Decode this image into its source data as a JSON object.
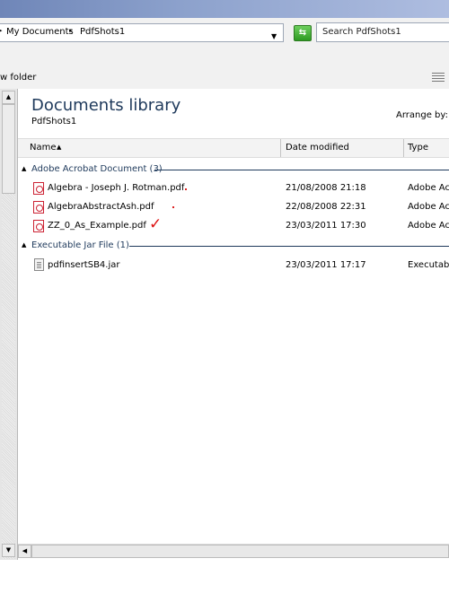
{
  "address": {
    "crumbs": [
      "My Documents",
      "PdfShots1"
    ],
    "search_placeholder": "Search PdfShots1"
  },
  "toolbar": {
    "new_folder_label": "w folder"
  },
  "library": {
    "title": "Documents library",
    "subtitle": "PdfShots1",
    "arrange_by_label": "Arrange by:"
  },
  "columns": {
    "name": "Name",
    "date": "Date modified",
    "type": "Type"
  },
  "groups": [
    {
      "label": "Adobe Acrobat Document (3)",
      "files": [
        {
          "name": "Algebra - Joseph J. Rotman.pdf",
          "date": "21/08/2008 21:18",
          "type": "Adobe Acr",
          "icon": "pdf-file-icon"
        },
        {
          "name": "AlgebraAbstractAsh.pdf",
          "date": "22/08/2008 22:31",
          "type": "Adobe Acr",
          "icon": "pdf-file-icon"
        },
        {
          "name": "ZZ_0_As_Example.pdf",
          "date": "23/03/2011 17:30",
          "type": "Adobe Acr",
          "icon": "pdf-file-icon"
        }
      ]
    },
    {
      "label": "Executable Jar File (1)",
      "files": [
        {
          "name": "pdfinsertSB4.jar",
          "date": "23/03/2011 17:17",
          "type": "Executable",
          "icon": "jar-file-icon"
        }
      ]
    }
  ],
  "colors": {
    "accent": "#1e395b",
    "annotation_red": "#dd1111",
    "titlebar": "#8ca1cc"
  }
}
